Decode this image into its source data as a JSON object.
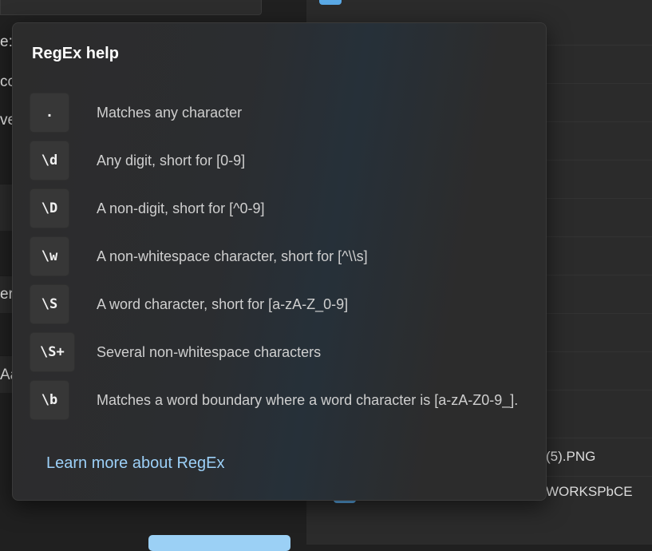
{
  "background": {
    "left_fragments": [
      "e:",
      "cc",
      "ve",
      "er",
      "Aa"
    ],
    "right_files": [
      "(5).PNG",
      "WORKSPbCE"
    ]
  },
  "regex_help": {
    "title": "RegEx help",
    "items": [
      {
        "token": ".",
        "description": "Matches any character"
      },
      {
        "token": "\\d",
        "description": "Any digit, short for [0-9]"
      },
      {
        "token": "\\D",
        "description": "A non-digit, short for [^0-9]"
      },
      {
        "token": "\\w",
        "description": "A non-whitespace character, short for [^\\\\s]"
      },
      {
        "token": "\\S",
        "description": "A word character, short for [a-zA-Z_0-9]"
      },
      {
        "token": "\\S+",
        "description": "Several non-whitespace characters"
      },
      {
        "token": "\\b",
        "description": "Matches a word boundary where a word character is [a-zA-Z0-9_]."
      }
    ],
    "learn_more_link": "Learn more about RegEx"
  },
  "colors": {
    "accent": "#9cd0f8",
    "flyout_bg": "#2c2c2c",
    "token_bg": "#373737"
  }
}
